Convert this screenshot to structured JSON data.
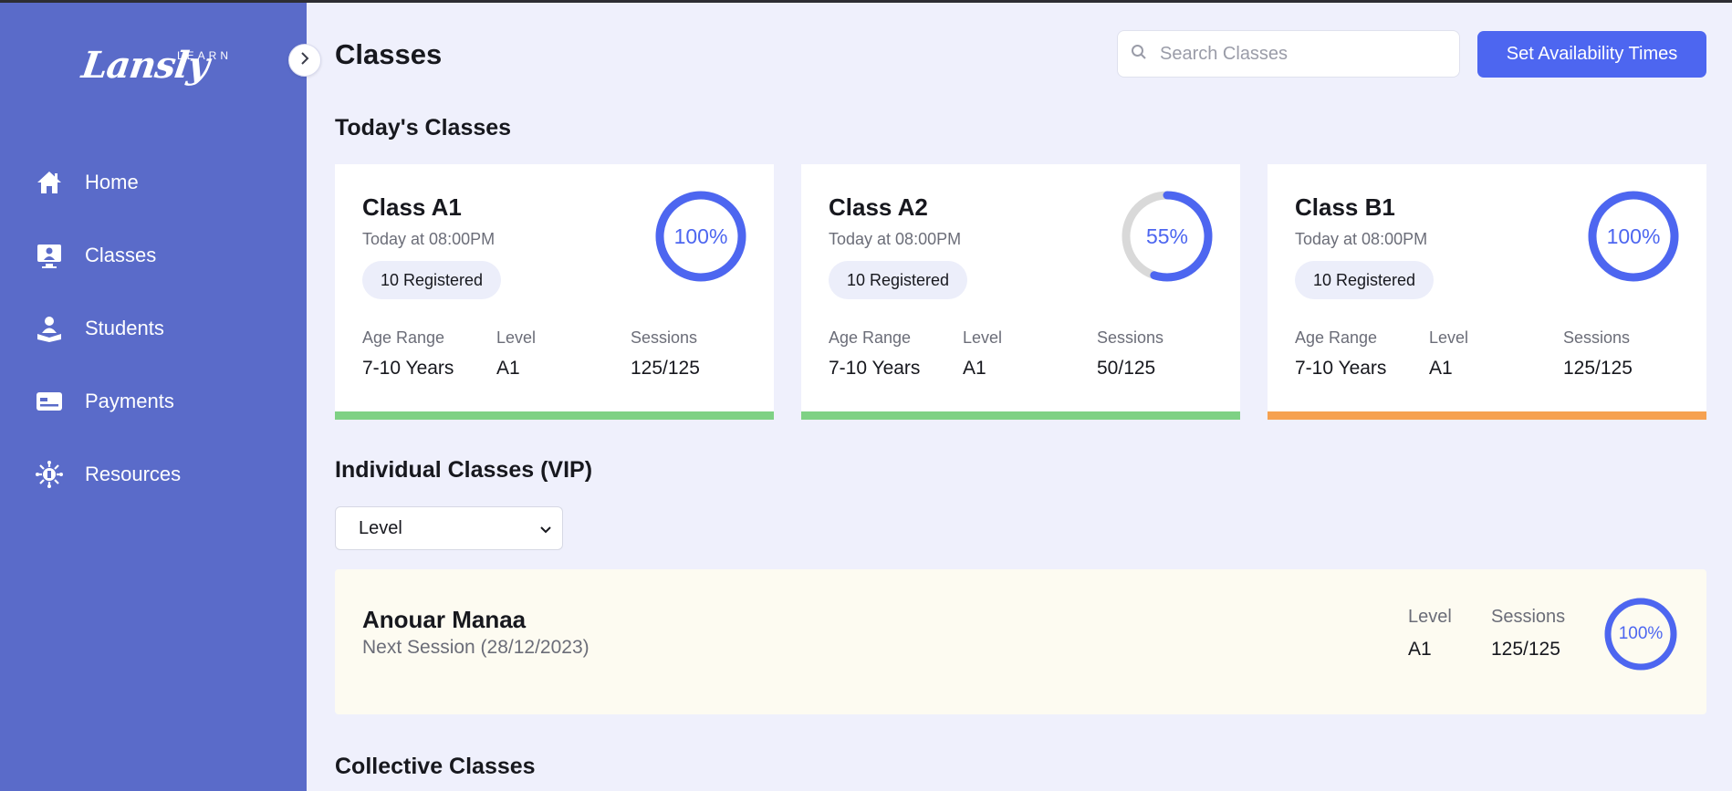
{
  "brand": {
    "name": "Lansly",
    "tagline": "LEARN"
  },
  "sidebar": {
    "items": [
      {
        "label": "Home",
        "icon": "home-icon"
      },
      {
        "label": "Classes",
        "icon": "classroom-icon"
      },
      {
        "label": "Students",
        "icon": "student-icon"
      },
      {
        "label": "Payments",
        "icon": "payment-card-icon"
      },
      {
        "label": "Resources",
        "icon": "resources-icon"
      }
    ]
  },
  "header": {
    "title": "Classes",
    "search_placeholder": "Search Classes",
    "availability_button": "Set Availability Times"
  },
  "todays": {
    "title": "Today's Classes",
    "stat_labels": {
      "age": "Age Range",
      "level": "Level",
      "sessions": "Sessions"
    },
    "cards": [
      {
        "name": "Class A1",
        "time": "Today at 08:00PM",
        "registered": "10 Registered",
        "percent_label": "100%",
        "percent": 100,
        "age": "7-10 Years",
        "level": "A1",
        "sessions": "125/125",
        "bar_color": "#7ed184"
      },
      {
        "name": "Class A2",
        "time": "Today at 08:00PM",
        "registered": "10 Registered",
        "percent_label": "55%",
        "percent": 55,
        "age": "7-10 Years",
        "level": "A1",
        "sessions": "50/125",
        "bar_color": "#7ed184"
      },
      {
        "name": "Class B1",
        "time": "Today at 08:00PM",
        "registered": "10 Registered",
        "percent_label": "100%",
        "percent": 100,
        "age": "7-10 Years",
        "level": "A1",
        "sessions": "125/125",
        "bar_color": "#f6a150"
      }
    ]
  },
  "individual": {
    "title": "Individual Classes (VIP)",
    "filter_value": "Level",
    "items": [
      {
        "student": "Anouar Manaa",
        "next_session": "Next Session (28/12/2023)",
        "level_label": "Level",
        "level": "A1",
        "sessions_label": "Sessions",
        "sessions": "125/125",
        "percent_label": "100%",
        "percent": 100
      }
    ]
  },
  "collective": {
    "title": "Collective Classes"
  },
  "colors": {
    "sidebar": "#5a6bc9",
    "accent": "#4d66f0",
    "track": "#d9d9d9",
    "background": "#eff0fc"
  }
}
